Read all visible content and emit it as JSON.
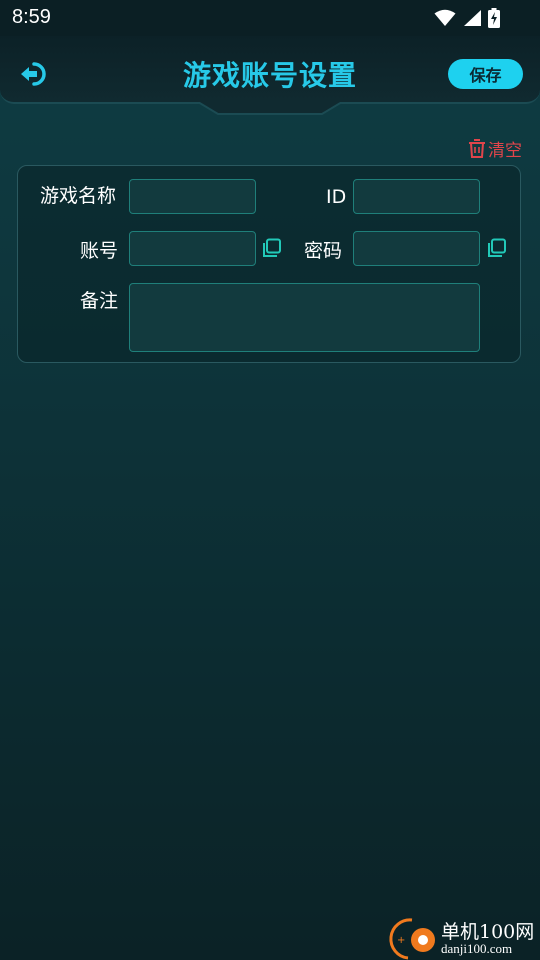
{
  "status_bar": {
    "time": "8:59",
    "icons": [
      "wifi-icon",
      "cellular-signal-icon",
      "battery-charging-icon"
    ]
  },
  "header": {
    "title": "游戏账号设置",
    "save_label": "保存",
    "back_icon": "back-arrow-icon"
  },
  "clear": {
    "label": "清空",
    "icon": "trash-icon",
    "color": "#e0454b"
  },
  "form": {
    "game_name": {
      "label": "游戏名称",
      "value": ""
    },
    "id": {
      "label": "ID",
      "value": ""
    },
    "account": {
      "label": "账号",
      "value": "",
      "copy_icon": "copy-icon"
    },
    "password": {
      "label": "密码",
      "value": "",
      "copy_icon": "copy-icon"
    },
    "note": {
      "label": "备注",
      "value": ""
    }
  },
  "watermark": {
    "name": "单机100网",
    "url": "danji100.com"
  },
  "colors": {
    "accent": "#27c9e8",
    "save_button": "#1ed1ef",
    "input_border": "#1f7f7a",
    "background": "#0d3238"
  }
}
